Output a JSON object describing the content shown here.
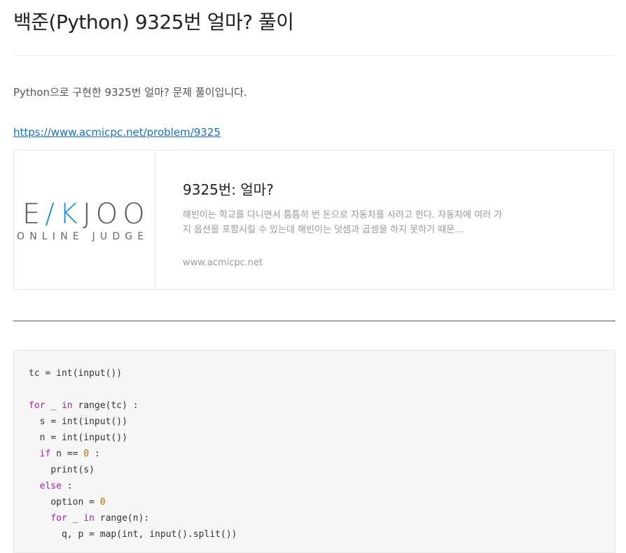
{
  "post": {
    "title": "백준(Python) 9325번 얼마? 풀이",
    "intro": "Python으로 구현한 9325번 얼마? 문제 풀이입니다.",
    "link": "https://www.acmicpc.net/problem/9325"
  },
  "card": {
    "logo_text_left": "E",
    "logo_text_accent": "/K",
    "logo_text_right": "JOO",
    "logo_sub": "ONLINE JUDGE",
    "title": "9325번: 얼마?",
    "description": "해빈이는 학교를 다니면서 틈틈히 번 돈으로 자동차를 사려고 한다. 자동차에 여러 가지 옵션을 포함시킬 수 있는데 해빈이는 덧셈과 곱셈을 하지 못하기 때문…",
    "host": "www.acmicpc.net"
  },
  "code": {
    "lines": [
      "tc = int(input())",
      "",
      "for _ in range(tc) :",
      "  s = int(input())",
      "  n = int(input())",
      "  if n == 0 :",
      "    print(s)",
      "  else :",
      "    option = 0",
      "    for _ in range(n):",
      "      q, p = map(int, input().split())"
    ]
  },
  "colors": {
    "link": "#1a6fc4",
    "keyword": "#a626a4",
    "number": "#b76b01",
    "logo_accent": "#2a8fd8"
  }
}
